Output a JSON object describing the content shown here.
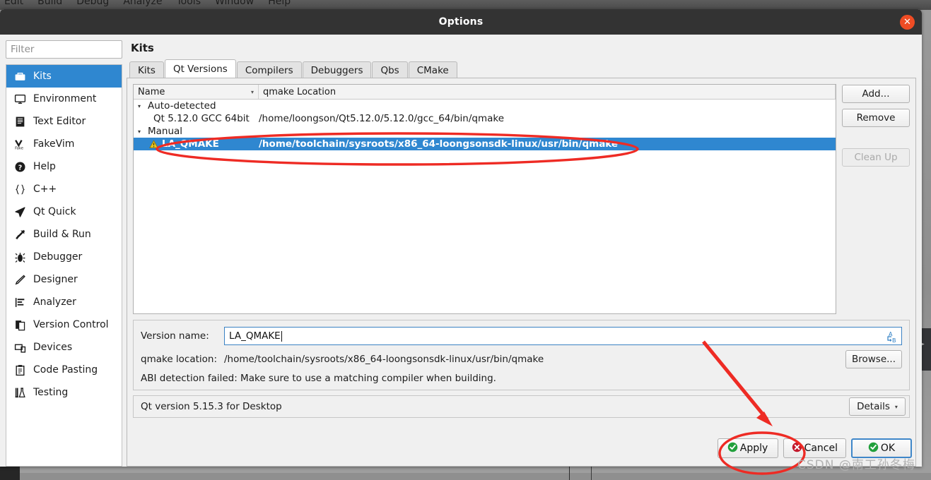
{
  "ide": {
    "menubar": [
      "Edit",
      "Build",
      "Debug",
      "Analyze",
      "Tools",
      "Window",
      "Help"
    ]
  },
  "dialog": {
    "title": "Options",
    "close_icon": "close-icon"
  },
  "sidebar": {
    "filter": {
      "value": "",
      "placeholder": "Filter"
    },
    "items": [
      {
        "label": "Kits",
        "icon": "kits-icon",
        "selected": true
      },
      {
        "label": "Environment",
        "icon": "monitor-icon",
        "selected": false
      },
      {
        "label": "Text Editor",
        "icon": "text-document-icon",
        "selected": false
      },
      {
        "label": "FakeVim",
        "icon": "fakevim-icon",
        "selected": false
      },
      {
        "label": "Help",
        "icon": "question-mark-icon",
        "selected": false
      },
      {
        "label": "C++",
        "icon": "braces-icon",
        "selected": false
      },
      {
        "label": "Qt Quick",
        "icon": "paper-plane-icon",
        "selected": false
      },
      {
        "label": "Build & Run",
        "icon": "hammer-icon",
        "selected": false
      },
      {
        "label": "Debugger",
        "icon": "bug-icon",
        "selected": false
      },
      {
        "label": "Designer",
        "icon": "pencil-icon",
        "selected": false
      },
      {
        "label": "Analyzer",
        "icon": "bar-chart-icon",
        "selected": false
      },
      {
        "label": "Version Control",
        "icon": "copy-pages-icon",
        "selected": false
      },
      {
        "label": "Devices",
        "icon": "devices-icon",
        "selected": false
      },
      {
        "label": "Code Pasting",
        "icon": "clipboard-icon",
        "selected": false
      },
      {
        "label": "Testing",
        "icon": "flask-icon",
        "selected": false
      }
    ]
  },
  "main": {
    "page_title": "Kits",
    "tabs": [
      {
        "label": "Kits",
        "active": false
      },
      {
        "label": "Qt Versions",
        "active": true
      },
      {
        "label": "Compilers",
        "active": false
      },
      {
        "label": "Debuggers",
        "active": false
      },
      {
        "label": "Qbs",
        "active": false
      },
      {
        "label": "CMake",
        "active": false
      }
    ],
    "tree": {
      "columns": [
        "Name",
        "qmake Location"
      ],
      "sort_indicator": "▾",
      "rows": [
        {
          "kind": "group",
          "name": "Auto-detected",
          "location": "",
          "expanded": true,
          "selected": false,
          "warning": false
        },
        {
          "kind": "child",
          "name": "Qt 5.12.0 GCC 64bit",
          "location": "/home/loongson/Qt5.12.0/5.12.0/gcc_64/bin/qmake",
          "selected": false,
          "warning": false
        },
        {
          "kind": "group",
          "name": "Manual",
          "location": "",
          "expanded": true,
          "selected": false,
          "warning": false
        },
        {
          "kind": "child",
          "name": "LA_QMAKE",
          "location": "/home/toolchain/sysroots/x86_64-loongsonsdk-linux/usr/bin/qmake",
          "selected": true,
          "warning": true
        }
      ]
    },
    "side_buttons": [
      {
        "label": "Add...",
        "disabled": false
      },
      {
        "label": "Remove",
        "disabled": false
      },
      {
        "label": "Clean Up",
        "disabled": true
      }
    ],
    "form": {
      "version_name_label": "Version name:",
      "version_name_value": "LA_QMAKE",
      "version_name_icon": "rename-ab-icon",
      "qmake_location_label": "qmake location:",
      "qmake_location_value": "/home/toolchain/sysroots/x86_64-loongsonsdk-linux/usr/bin/qmake",
      "browse_label": "Browse...",
      "abi_message": "ABI detection failed: Make sure to use a matching compiler when building."
    },
    "status": {
      "text": "Qt version 5.15.3 for Desktop",
      "details_label": "Details",
      "details_caret": "▾"
    }
  },
  "footer": {
    "buttons": [
      {
        "label": "Apply",
        "icon": "check-circle-green-icon",
        "mnemonic": "",
        "default": false
      },
      {
        "label": "Cancel",
        "icon": "cross-circle-red-icon",
        "mnemonic": "C",
        "default": false
      },
      {
        "label": "OK",
        "icon": "check-circle-green-icon",
        "mnemonic": "O",
        "default": true
      }
    ]
  },
  "annotations": {
    "color": "#ee2b24",
    "ellipse_row_label": "highlight-ellipse-selected-qt-version",
    "ellipse_apply_label": "highlight-ellipse-apply-button",
    "arrow_label": "arrow-pointing-to-apply"
  },
  "watermark": {
    "text": "CSDN @南工孙冬梅"
  }
}
